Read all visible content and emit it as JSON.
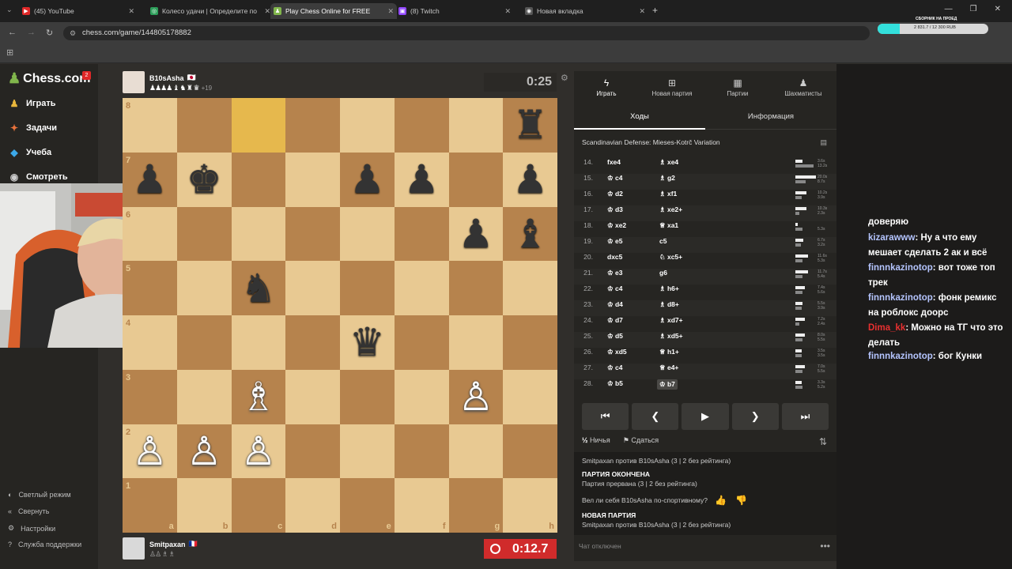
{
  "tabs": [
    {
      "label": "(45) YouTube",
      "color": "#e02828",
      "glyph": "▶"
    },
    {
      "label": "Колесо удачи | Определите по",
      "color": "#2d9e5a",
      "glyph": "◎"
    },
    {
      "label": "Play Chess Online for FREE",
      "color": "#81b64c",
      "glyph": "♟"
    },
    {
      "label": "(8) Twitch",
      "color": "#9147ff",
      "glyph": "▣"
    },
    {
      "label": "Новая вкладка",
      "color": "#555",
      "glyph": "◉"
    }
  ],
  "address": {
    "url": "chess.com/game/144805178882"
  },
  "stream_widget": {
    "title": "СБОРНИК НА ПРОЕД",
    "amount": "2 831.7 / 12 300 RUB",
    "progress": 0.2
  },
  "sidebar": {
    "brand": "Chess.com",
    "brand_badge": "2",
    "items": [
      {
        "label": "Играть",
        "icon": "play-icon",
        "color": "#e8b63c"
      },
      {
        "label": "Задачи",
        "icon": "puzzle-icon",
        "color": "#e8723c"
      },
      {
        "label": "Учеба",
        "icon": "learn-icon",
        "color": "#3ca8e8"
      },
      {
        "label": "Смотреть",
        "icon": "watch-icon",
        "color": "#ccc"
      }
    ],
    "bottom": [
      {
        "label": "Светлый режим",
        "icon": "light-mode-icon"
      },
      {
        "label": "Свернуть",
        "icon": "collapse-icon"
      },
      {
        "label": "Настройки",
        "icon": "settings-icon"
      },
      {
        "label": "Служба поддержки",
        "icon": "help-icon"
      }
    ]
  },
  "top_player": {
    "name": "B10sAsha",
    "flag": "🇯🇵",
    "captured": "♟♟♟♟ ♝ ♞ ♜ ♛",
    "advantage": "+19",
    "clock": "0:25"
  },
  "bottom_player": {
    "name": "Smitpaxan",
    "flag": "🇫🇷",
    "captured": "♙♙ ♗ ♗",
    "clock": "0:12.7"
  },
  "board": {
    "ranks": [
      "8",
      "7",
      "6",
      "5",
      "4",
      "3",
      "2",
      "1"
    ],
    "files": [
      "a",
      "b",
      "c",
      "d",
      "e",
      "f",
      "g",
      "h"
    ],
    "pieces": [
      {
        "sq": "h8",
        "g": "♜",
        "c": "b"
      },
      {
        "sq": "a7",
        "g": "♟",
        "c": "b"
      },
      {
        "sq": "b7",
        "g": "♚",
        "c": "b"
      },
      {
        "sq": "e7",
        "g": "♟",
        "c": "b"
      },
      {
        "sq": "f7",
        "g": "♟",
        "c": "b"
      },
      {
        "sq": "h7",
        "g": "♟",
        "c": "b"
      },
      {
        "sq": "g6",
        "g": "♟",
        "c": "b"
      },
      {
        "sq": "h6",
        "g": "♝",
        "c": "b"
      },
      {
        "sq": "c5",
        "g": "♞",
        "c": "b"
      },
      {
        "sq": "e4",
        "g": "♛",
        "c": "b"
      },
      {
        "sq": "c3",
        "g": "♗",
        "c": "w"
      },
      {
        "sq": "g3",
        "g": "♙",
        "c": "w"
      },
      {
        "sq": "a2",
        "g": "♙",
        "c": "w"
      },
      {
        "sq": "b2",
        "g": "♙",
        "c": "w"
      },
      {
        "sq": "c2",
        "g": "♙",
        "c": "w"
      }
    ],
    "highlight": [
      "c8"
    ]
  },
  "panel": {
    "tabs": [
      {
        "label": "Играть",
        "icon": "bolt-icon"
      },
      {
        "label": "Новая партия",
        "icon": "plus-icon"
      },
      {
        "label": "Партии",
        "icon": "grid-icon"
      },
      {
        "label": "Шахматисты",
        "icon": "players-icon"
      }
    ],
    "subtabs": [
      "Ходы",
      "Информация"
    ],
    "opening": "Scandinavian Defense: Mieses-Kotrč Variation",
    "moves": [
      {
        "n": "14.",
        "w": "fxe4",
        "wp": "",
        "b": "xe4",
        "bp": "♗",
        "t": [
          "3.6s",
          "13.2s"
        ],
        "f": [
          0.35,
          0.9
        ]
      },
      {
        "n": "15.",
        "w": "c4",
        "wp": "♔",
        "b": "g2",
        "bp": "♗",
        "t": [
          "20.0s",
          "8.7s"
        ],
        "f": [
          1,
          0.5
        ]
      },
      {
        "n": "16.",
        "w": "d2",
        "wp": "♔",
        "b": "xf1",
        "bp": "♗",
        "t": [
          "10.2s",
          "3.9s"
        ],
        "f": [
          0.55,
          0.3
        ]
      },
      {
        "n": "17.",
        "w": "d3",
        "wp": "♔",
        "b": "xe2+",
        "bp": "♗",
        "t": [
          "10.3s",
          "2.3s"
        ],
        "f": [
          0.55,
          0.2
        ]
      },
      {
        "n": "18.",
        "w": "xe2",
        "wp": "♔",
        "b": "xa1",
        "bp": "♕",
        "t": [
          "",
          "5.3s"
        ],
        "f": [
          0.1,
          0.35
        ]
      },
      {
        "n": "19.",
        "w": "e5",
        "wp": "♔",
        "b": "c5",
        "bp": "",
        "t": [
          "6.7s",
          "3.2s"
        ],
        "f": [
          0.4,
          0.25
        ]
      },
      {
        "n": "20.",
        "w": "dxc5",
        "wp": "",
        "b": "xc5+",
        "bp": "♘",
        "t": [
          "11.6s",
          "5.3s"
        ],
        "f": [
          0.6,
          0.35
        ]
      },
      {
        "n": "21.",
        "w": "e3",
        "wp": "♔",
        "b": "g6",
        "bp": "",
        "t": [
          "11.7s",
          "5.4s"
        ],
        "f": [
          0.6,
          0.35
        ]
      },
      {
        "n": "22.",
        "w": "c4",
        "wp": "♔",
        "b": "h6+",
        "bp": "♗",
        "t": [
          "7.4s",
          "5.6s"
        ],
        "f": [
          0.45,
          0.35
        ]
      },
      {
        "n": "23.",
        "w": "d4",
        "wp": "♔",
        "b": "d8+",
        "bp": "♗",
        "t": [
          "5.5s",
          "3.9s"
        ],
        "f": [
          0.35,
          0.3
        ]
      },
      {
        "n": "24.",
        "w": "d7",
        "wp": "♔",
        "b": "xd7+",
        "bp": "♗",
        "t": [
          "7.2s",
          "2.4s"
        ],
        "f": [
          0.45,
          0.2
        ]
      },
      {
        "n": "25.",
        "w": "d5",
        "wp": "♔",
        "b": "xd5+",
        "bp": "♗",
        "t": [
          "8.0s",
          "5.5s"
        ],
        "f": [
          0.45,
          0.35
        ]
      },
      {
        "n": "26.",
        "w": "xd5",
        "wp": "♔",
        "b": "h1+",
        "bp": "♕",
        "t": [
          "3.5s",
          "3.5s"
        ],
        "f": [
          0.3,
          0.3
        ]
      },
      {
        "n": "27.",
        "w": "c4",
        "wp": "♔",
        "b": "e4+",
        "bp": "♕",
        "t": [
          "7.0s",
          "5.5s"
        ],
        "f": [
          0.45,
          0.35
        ]
      },
      {
        "n": "28.",
        "w": "b5",
        "wp": "♔",
        "b": "b7",
        "bp": "♔",
        "t": [
          "3.3s",
          "5.2s"
        ],
        "f": [
          0.3,
          0.35
        ]
      }
    ],
    "draw": "Ничья",
    "resign": "Сдаться",
    "log": {
      "line0": "Smitpaxan против B10sAsha (3 | 2 без рейтинга)",
      "over_head": "ПАРТИЯ ОКОНЧЕНА",
      "over_text": "Партия прервана (3 | 2 без рейтинга)",
      "sport_q": "Вел ли себя B10sAsha по-спортивному?",
      "new_head": "НОВАЯ ПАРТИЯ",
      "new_text": "Smitpaxan против B10sAsha (3 | 2 без рейтинга)"
    },
    "chat_disabled": "Чат отключен"
  },
  "twitch_chat": [
    {
      "user": "",
      "text": "доверяю"
    },
    {
      "user": "kizarawww",
      "text": "Ну а что ему мешает сделать 2 ак и всё",
      "uc": "u1"
    },
    {
      "user": "finnnkazinotop",
      "text": "вот тоже топ трек",
      "uc": "u1"
    },
    {
      "user": "finnnkazinotop",
      "text": "фонк ремикс на роблокс доорс",
      "uc": "u1"
    },
    {
      "user": "Dima_kk",
      "text": "Можно на ТГ что это делать",
      "uc": "u2"
    },
    {
      "user": "finnnkazinotop",
      "text": "бог Кунки",
      "uc": "u1"
    }
  ]
}
